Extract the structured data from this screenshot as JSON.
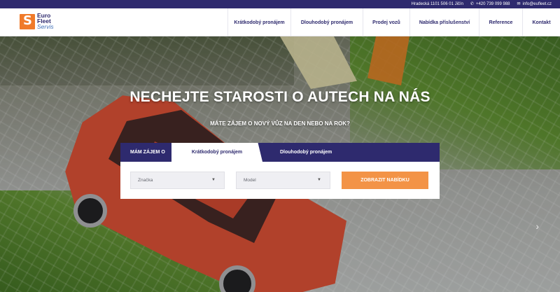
{
  "topbar": {
    "address": "Hradecká 1101 506 01 Jičín",
    "phone": "+420 739 099 988",
    "email": "info@eufleet.cz",
    "phone_icon": "phone-icon",
    "email_icon": "mail-icon"
  },
  "header": {
    "logo": {
      "line1": "Euro",
      "line2": "Fleet",
      "line3": "Servis",
      "mark": "S"
    },
    "nav": [
      {
        "label": "Krátkodobý pronájem"
      },
      {
        "label": "Dlouhodobý pronájem"
      },
      {
        "label": "Prodej vozů"
      },
      {
        "label": "Nabídka příslušenství"
      },
      {
        "label": "Reference"
      },
      {
        "label": "Kontakt"
      }
    ]
  },
  "hero": {
    "title": "NECHEJTE STAROSTI O AUTECH NA NÁS",
    "subtitle": "MÁTE ZÁJEM O NOVÝ VŮZ NA DEN NEBO NA ROK?"
  },
  "search": {
    "tab_prefix": "MÁM ZÁJEM O",
    "tabs": [
      {
        "label": "Krátkodobý pronájem",
        "active": true
      },
      {
        "label": "Dlouhodobý pronájem",
        "active": false
      }
    ],
    "brand_select": "Značka",
    "model_select": "Model",
    "submit_label": "ZOBRAZIT NABÍDKU"
  },
  "colors": {
    "primary": "#2e2a6e",
    "accent": "#f39346",
    "logo_orange": "#f07a2a",
    "white": "#ffffff"
  }
}
